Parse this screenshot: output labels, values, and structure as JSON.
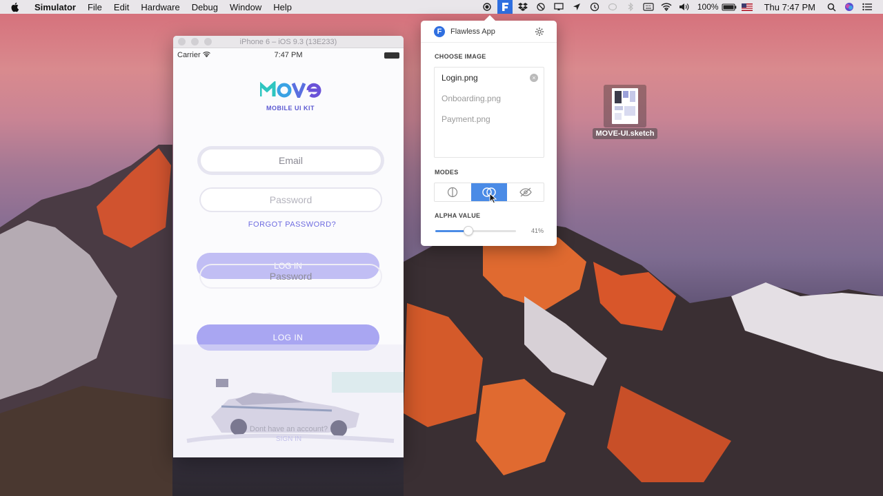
{
  "menubar": {
    "apple_icon": "apple-icon",
    "app_name": "Simulator",
    "items": [
      "File",
      "Edit",
      "Hardware",
      "Debug",
      "Window",
      "Help"
    ],
    "status_icons": [
      "record-icon",
      "flawless-icon",
      "dropbox-icon",
      "block-icon",
      "cast-icon",
      "location-icon",
      "time-machine-icon",
      "chat-icon",
      "bluetooth-icon",
      "keyboard-icon",
      "wifi-icon"
    ],
    "volume_icon": "volume-icon",
    "battery_text": "100%",
    "clock": "Thu 7:47 PM",
    "search_icon": "search-icon",
    "siri_icon": "siri-icon",
    "list_icon": "list-icon"
  },
  "simulator": {
    "title": "iPhone 6 – iOS 9.3 (13E233)",
    "statusbar": {
      "carrier": "Carrier",
      "time": "7:47 PM"
    },
    "app": {
      "logo_text": "MOVE",
      "kit_label": "MOBILE UI KIT",
      "email_placeholder": "Email",
      "password_placeholder": "Password",
      "forgot_label": "FORGOT PASSWORD?",
      "ghost_login_label": "LOG IN",
      "ghost_password_label": "Password",
      "login_label": "LOG IN",
      "no_account_text": "Dont have an account?",
      "signin_label": "SIGN IN"
    }
  },
  "flawless": {
    "app_name": "Flawless App",
    "choose_image_label": "CHOOSE IMAGE",
    "images": [
      {
        "name": "Login.png",
        "selected": true
      },
      {
        "name": "Onboarding.png",
        "selected": false
      },
      {
        "name": "Payment.png",
        "selected": false
      }
    ],
    "modes_label": "MODES",
    "modes": [
      {
        "icon": "overlay-split-icon",
        "active": false
      },
      {
        "icon": "overlay-blend-icon",
        "active": true
      },
      {
        "icon": "hide-eye-icon",
        "active": false
      }
    ],
    "alpha_label": "ALPHA VALUE",
    "alpha_value": 41,
    "alpha_text": "41%"
  },
  "desktop": {
    "file_name": "MOVE-UI.sketch"
  },
  "colors": {
    "accent_blue": "#4a8be6",
    "brand_purple": "#5b58d1"
  }
}
